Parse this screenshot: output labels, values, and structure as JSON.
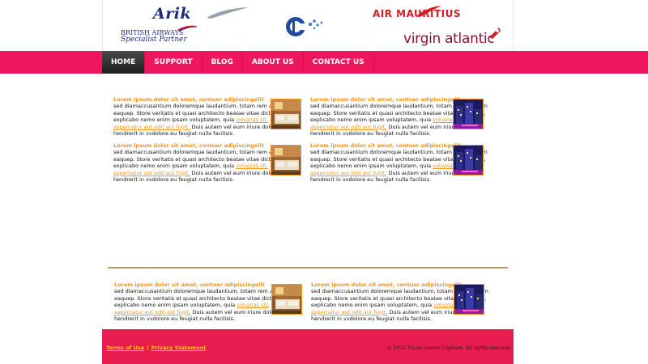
{
  "header": {
    "logos": {
      "arik": "Arik",
      "ba_line1": "BRITISH AIRWAYS",
      "ba_line2": "Specialist Partner",
      "icc": "ICC",
      "air_mauritius": "AIR MAURITIUS",
      "virgin": "virgin atlantic"
    }
  },
  "nav": {
    "items": [
      {
        "label": "HOME"
      },
      {
        "label": "SUPPORT"
      },
      {
        "label": "BLOG"
      },
      {
        "label": "ABOUT US"
      },
      {
        "label": "CONTACT US"
      }
    ],
    "active": "HOME"
  },
  "article": {
    "title": "Lorem ipsum dolor sit amet, contuer adipiscingelit",
    "body_a": "sed diamaccusantium doloremque laudantium, totam rem aperiam eaquep. Store veritatis et quasi architecto beatae vitae dicta sunt, explicabo nemo enim ipsam voluptatem, quia ",
    "link": "voluptas sit, aspernatur aut odit aut fugit.",
    "body_b": " Duis autem vel eum iriure dolor in hendrerit in vvdolore eu feugiat nulla facilisis."
  },
  "footer": {
    "terms": "Terms of Use",
    "separator": "|",
    "privacy": "Privacy Statement",
    "copyright": "© 2012 Travel Centre Clapham. All rights reserved"
  },
  "colors": {
    "brand_pink": "#f0165e",
    "footer_red": "#e81c4f",
    "accent_orange": "#f7931e",
    "link_yellow": "#ffcc00"
  },
  "icons": {
    "thumb_bed": "hotel-bedroom-image",
    "thumb_city": "city-night-image"
  }
}
